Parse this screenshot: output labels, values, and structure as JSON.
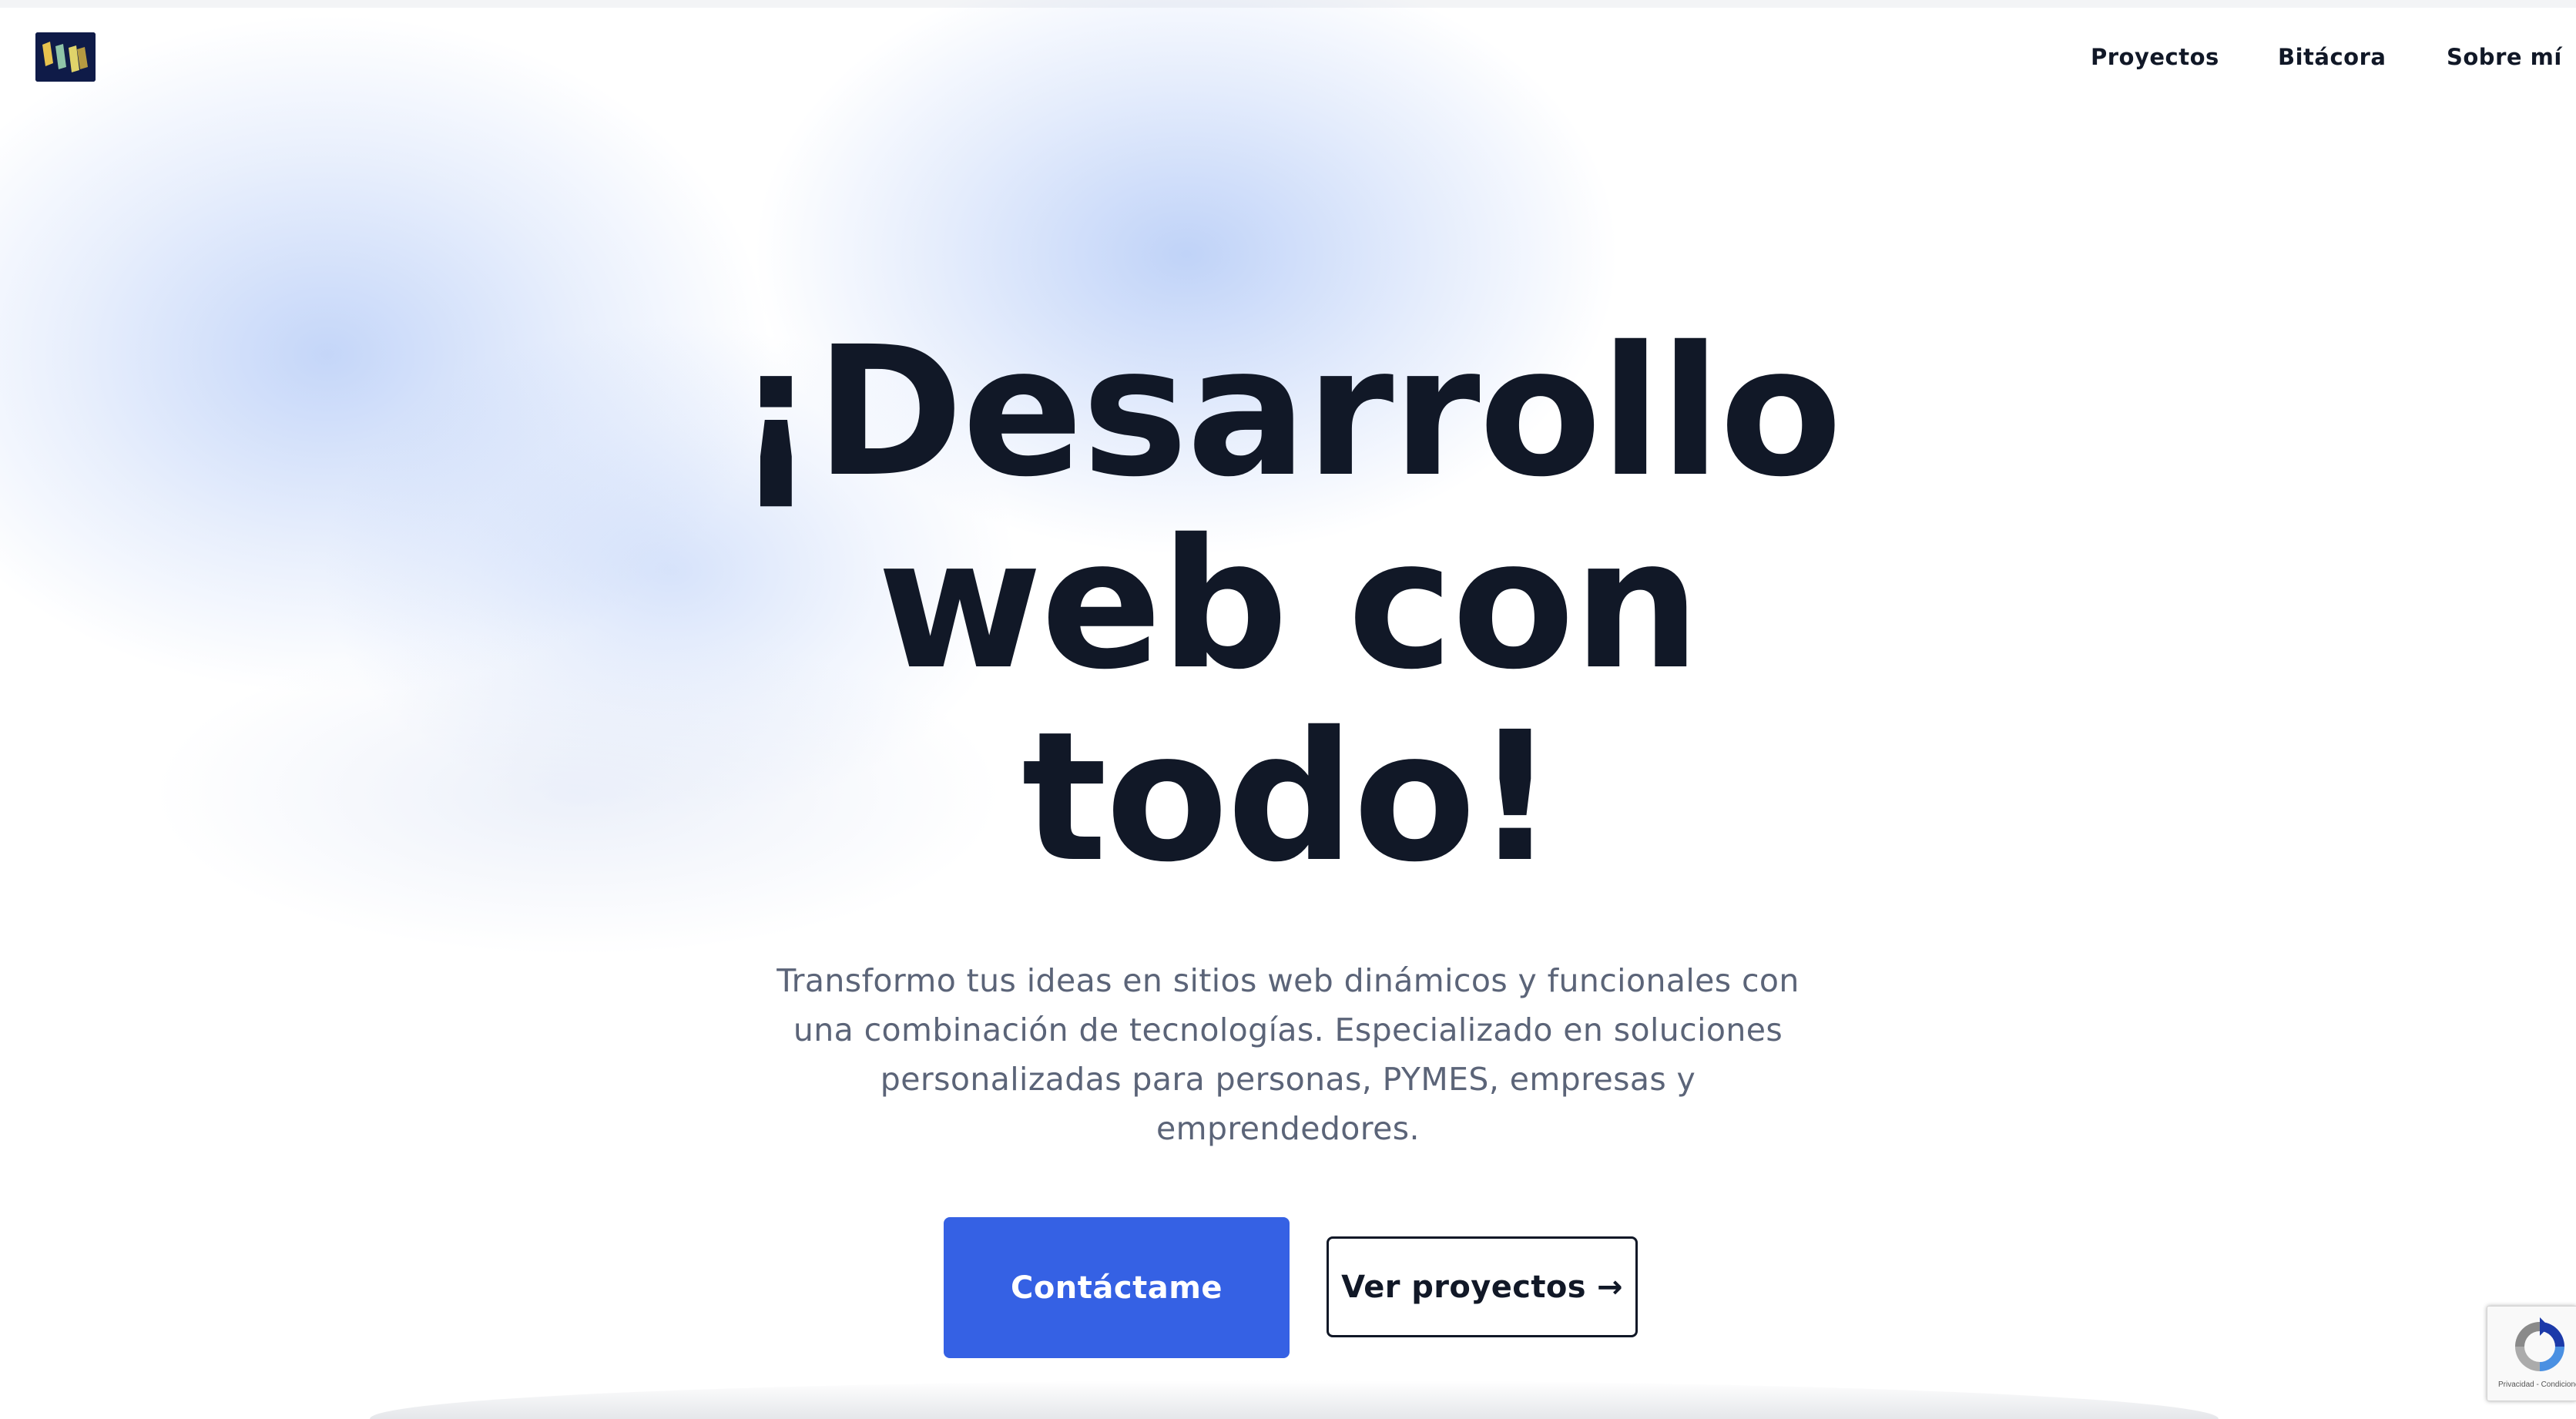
{
  "header": {
    "logo_name": "logo-mark",
    "nav": [
      {
        "label": "Proyectos"
      },
      {
        "label": "Bitácora"
      },
      {
        "label": "Sobre mí"
      }
    ]
  },
  "hero": {
    "title_lines": [
      "¡Desarrollo",
      "web con",
      "todo!"
    ],
    "description_lines": [
      "Transformo tus ideas en sitios web dinámicos y funcionales con",
      "una combinación de tecnologías. Especializado en soluciones",
      "personalizadas para personas, PYMES, empresas y",
      "emprendedores."
    ],
    "primary_button": "Contáctame",
    "secondary_button": "Ver proyectos",
    "secondary_button_arrow": "→"
  },
  "recaptcha": {
    "footer_text": "Privacidad - Condiciones"
  },
  "colors": {
    "accent": "#3561e4",
    "text_dark": "#111827",
    "text_muted": "#5b6478",
    "logo_bg": "#0f1b48"
  }
}
